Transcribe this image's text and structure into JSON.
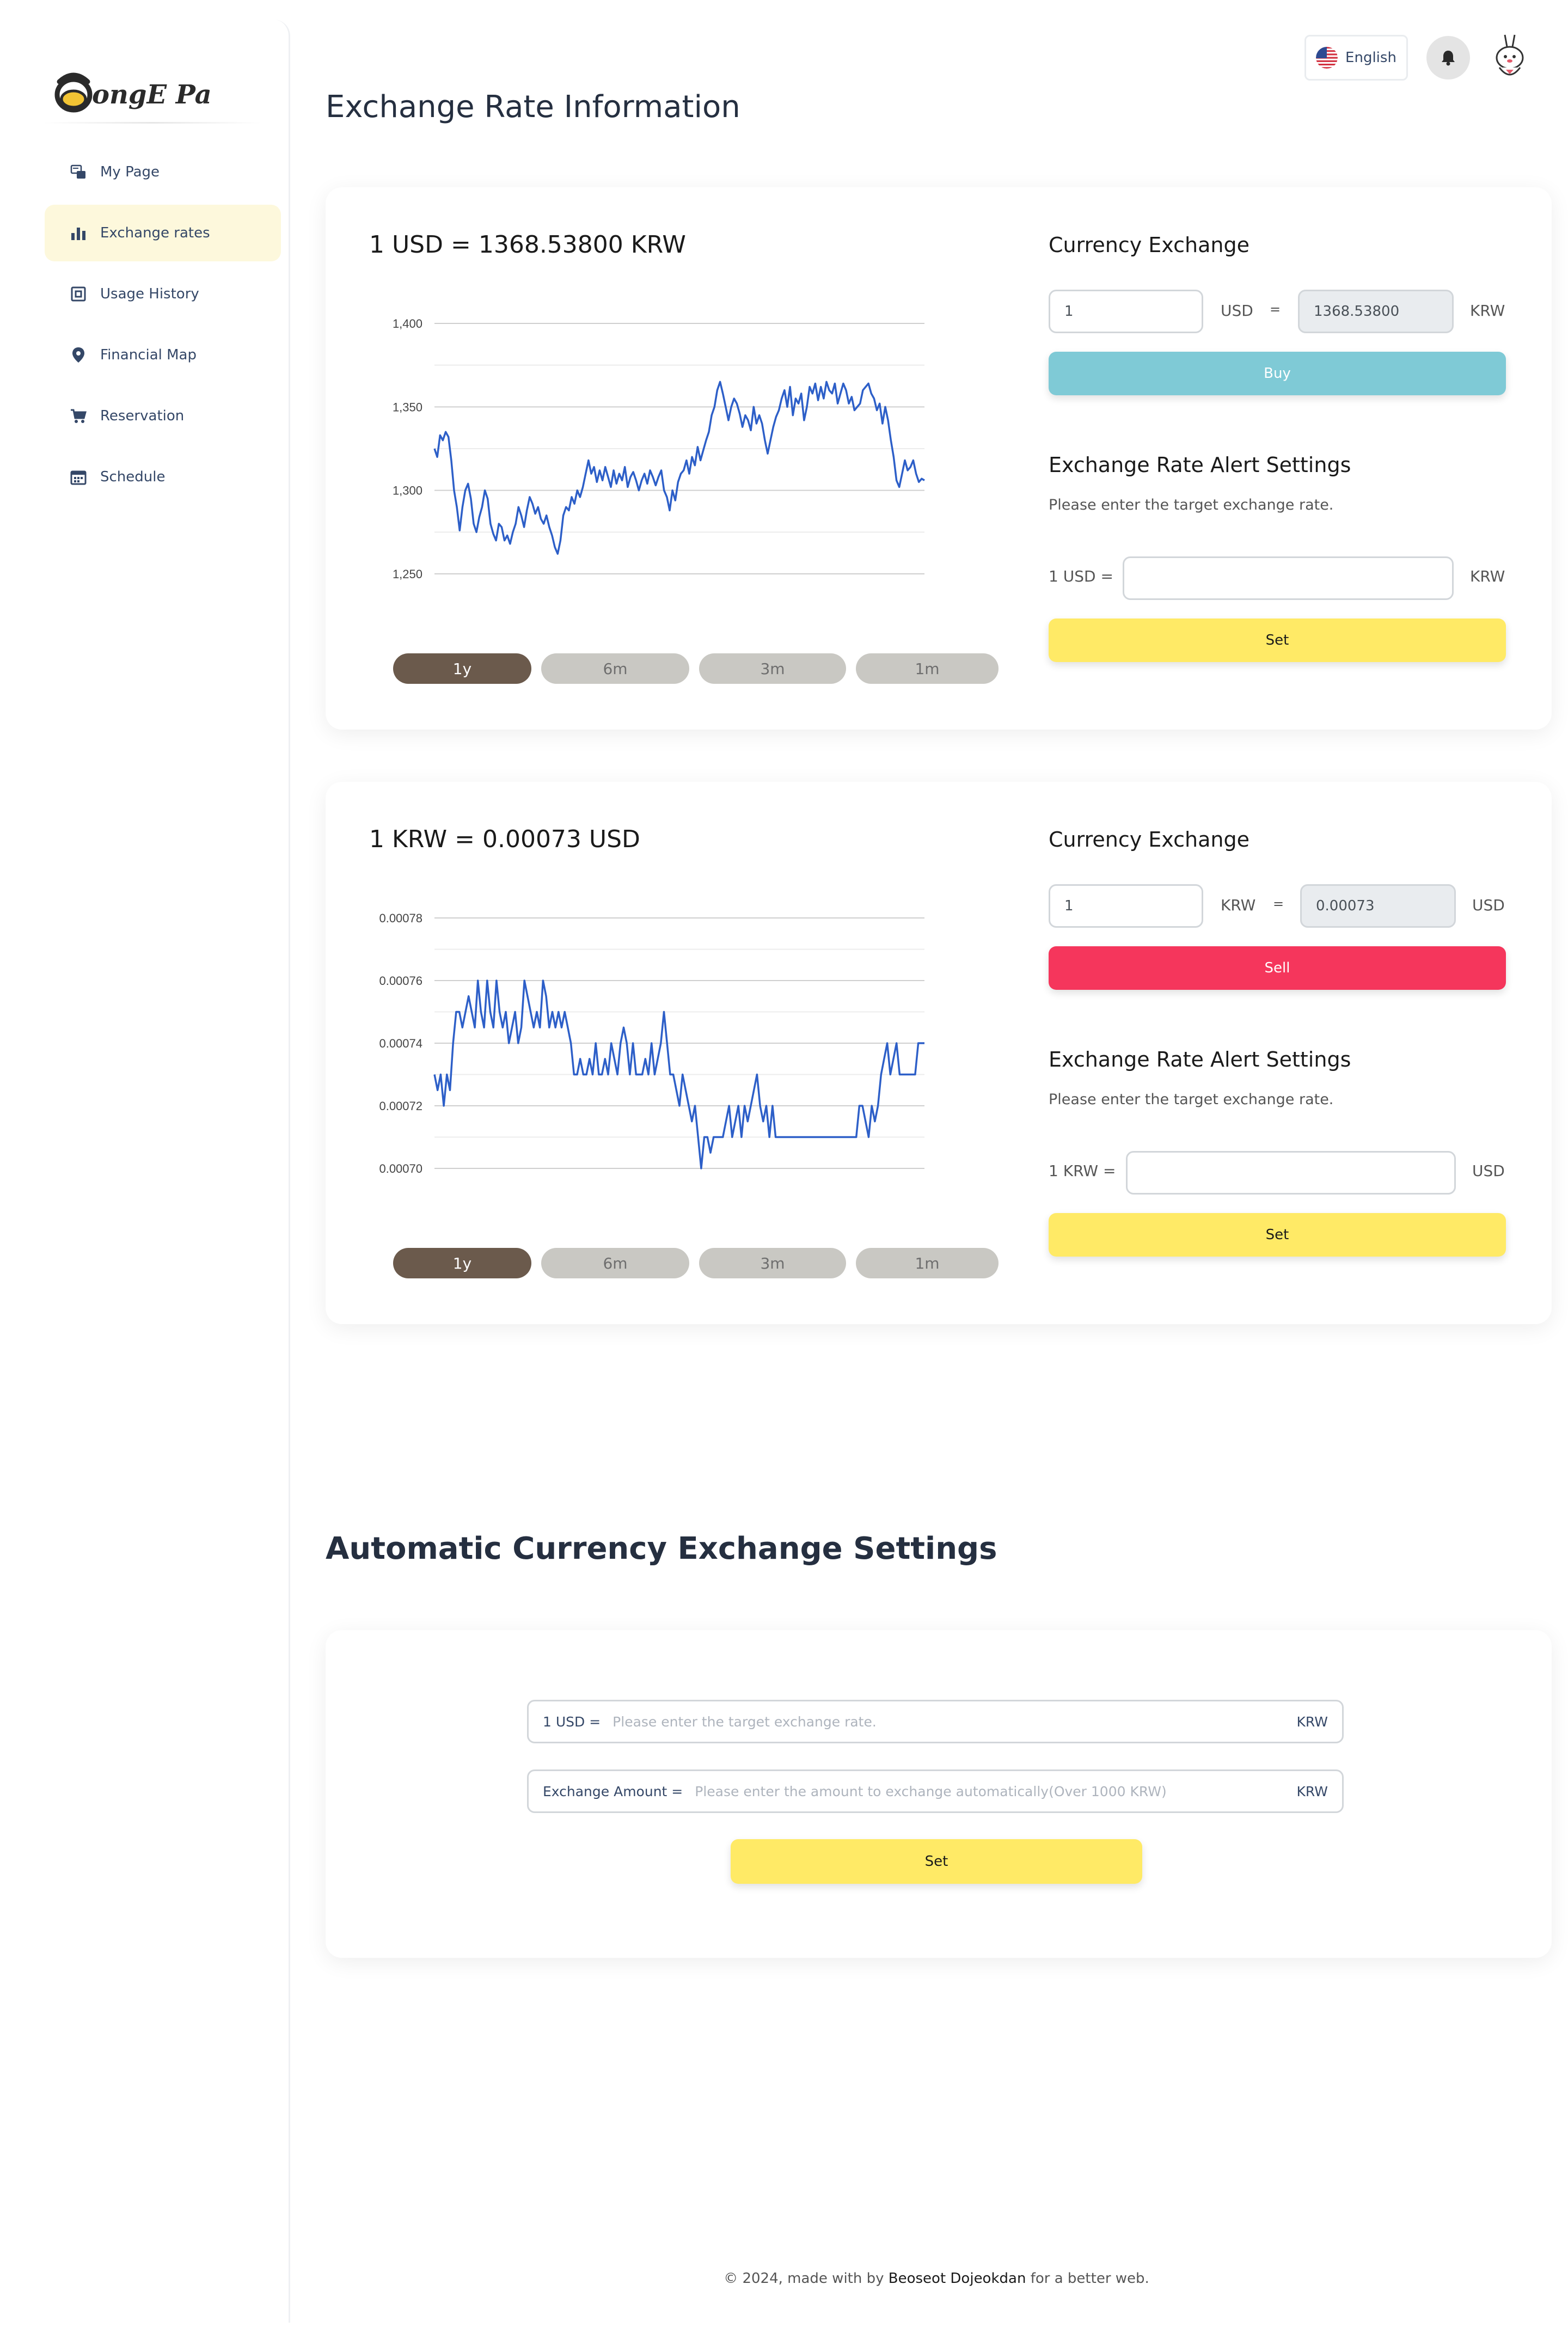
{
  "app": {
    "logo_text": "SongE Pay"
  },
  "sidebar": {
    "items": [
      {
        "label": "My Page",
        "icon": "mypage-icon"
      },
      {
        "label": "Exchange rates",
        "icon": "bar-chart-icon",
        "active": true
      },
      {
        "label": "Usage History",
        "icon": "receipt-icon"
      },
      {
        "label": "Financial Map",
        "icon": "location-pin-icon"
      },
      {
        "label": "Reservation",
        "icon": "cart-icon"
      },
      {
        "label": "Schedule",
        "icon": "calendar-icon"
      }
    ]
  },
  "topbar": {
    "language": "English"
  },
  "page": {
    "title": "Exchange Rate Information"
  },
  "usd_card": {
    "rate_title": "1 USD = 1368.53800 KRW",
    "periods": [
      "1y",
      "6m",
      "3m",
      "1m"
    ],
    "active_period": "1y",
    "exchange": {
      "title": "Currency Exchange",
      "input_value": "1",
      "from_unit": "USD",
      "equals": "=",
      "result_value": "1368.53800",
      "to_unit": "KRW",
      "button": "Buy"
    },
    "alert": {
      "title": "Exchange Rate Alert Settings",
      "subtitle": "Please enter the target exchange rate.",
      "label": "1 USD =",
      "unit": "KRW",
      "input_value": "",
      "button": "Set"
    }
  },
  "krw_card": {
    "rate_title": "1 KRW = 0.00073 USD",
    "periods": [
      "1y",
      "6m",
      "3m",
      "1m"
    ],
    "active_period": "1y",
    "exchange": {
      "title": "Currency Exchange",
      "input_value": "1",
      "from_unit": "KRW",
      "equals": "=",
      "result_value": "0.00073",
      "to_unit": "USD",
      "button": "Sell"
    },
    "alert": {
      "title": "Exchange Rate Alert Settings",
      "subtitle": "Please enter the target exchange rate.",
      "label": "1 KRW =",
      "unit": "USD",
      "input_value": "",
      "button": "Set"
    }
  },
  "auto": {
    "title": "Automatic Currency Exchange Settings",
    "rate_label": "1 USD =",
    "rate_placeholder": "Please enter the target exchange rate.",
    "rate_unit": "KRW",
    "amount_label": "Exchange Amount =",
    "amount_placeholder": "Please enter the amount to exchange automatically(Over 1000 KRW)",
    "amount_unit": "KRW",
    "button": "Set"
  },
  "footer": {
    "prefix": "© 2024, made with by",
    "author": "Beoseot Dojeokdan",
    "suffix": "for a better web."
  },
  "colors": {
    "accent_yellow": "#ffea66",
    "buy": "#7fcad6",
    "sell": "#f5365c",
    "line": "#2d5fc8",
    "period_active": "#6b5a4c"
  },
  "chart_data": [
    {
      "type": "line",
      "title": "1 USD = 1368.53800 KRW",
      "xlabel": "",
      "ylabel": "",
      "ylim": [
        1250,
        1400
      ],
      "yticks": [
        1250,
        1300,
        1350,
        1400
      ],
      "ytick_labels": [
        "1,250",
        "1,300",
        "1,350",
        "1,400"
      ],
      "grid": true,
      "series": [
        {
          "values": [
            1325,
            1320,
            1333,
            1330,
            1335,
            1332,
            1318,
            1300,
            1290,
            1276,
            1290,
            1300,
            1304,
            1295,
            1280,
            1275,
            1284,
            1290,
            1300,
            1295,
            1280,
            1274,
            1270,
            1280,
            1278,
            1270,
            1273,
            1268,
            1275,
            1280,
            1290,
            1285,
            1278,
            1288,
            1296,
            1292,
            1286,
            1290,
            1283,
            1280,
            1285,
            1278,
            1273,
            1266,
            1262,
            1270,
            1285,
            1290,
            1288,
            1296,
            1292,
            1300,
            1296,
            1302,
            1310,
            1318,
            1310,
            1314,
            1305,
            1312,
            1306,
            1314,
            1308,
            1302,
            1312,
            1304,
            1310,
            1306,
            1314,
            1302,
            1308,
            1311,
            1306,
            1300,
            1306,
            1310,
            1304,
            1312,
            1308,
            1303,
            1308,
            1312,
            1300,
            1296,
            1288,
            1300,
            1294,
            1305,
            1310,
            1312,
            1318,
            1310,
            1320,
            1315,
            1326,
            1318,
            1324,
            1330,
            1335,
            1345,
            1350,
            1360,
            1365,
            1358,
            1350,
            1342,
            1350,
            1355,
            1352,
            1346,
            1338,
            1345,
            1342,
            1336,
            1350,
            1340,
            1345,
            1340,
            1330,
            1322,
            1330,
            1338,
            1344,
            1348,
            1355,
            1360,
            1350,
            1362,
            1345,
            1355,
            1352,
            1358,
            1342,
            1350,
            1362,
            1358,
            1364,
            1354,
            1362,
            1355,
            1365,
            1360,
            1358,
            1364,
            1352,
            1358,
            1364,
            1360,
            1352,
            1356,
            1348,
            1350,
            1352,
            1360,
            1362,
            1364,
            1358,
            1355,
            1348,
            1352,
            1340,
            1350,
            1342,
            1330,
            1320,
            1306,
            1302,
            1310,
            1318,
            1312,
            1314,
            1318,
            1310,
            1305,
            1307,
            1306
          ]
        }
      ]
    },
    {
      "type": "line",
      "title": "1 KRW = 0.00073 USD",
      "xlabel": "",
      "ylabel": "",
      "ylim": [
        0.0007,
        0.00078
      ],
      "yticks": [
        0.0007,
        0.00072,
        0.00074,
        0.00076,
        0.00078
      ],
      "ytick_labels": [
        "0.00070",
        "0.00072",
        "0.00074",
        "0.00076",
        "0.00078"
      ],
      "grid": true,
      "series": [
        {
          "values": [
            0.00073,
            0.000725,
            0.00073,
            0.00072,
            0.00073,
            0.000725,
            0.00074,
            0.00075,
            0.00075,
            0.000745,
            0.00075,
            0.000755,
            0.00075,
            0.000745,
            0.00076,
            0.00075,
            0.000745,
            0.00076,
            0.00075,
            0.000745,
            0.00076,
            0.00075,
            0.000745,
            0.00075,
            0.00074,
            0.000745,
            0.00075,
            0.00074,
            0.000745,
            0.00076,
            0.000755,
            0.00075,
            0.000745,
            0.00075,
            0.000745,
            0.00076,
            0.000755,
            0.000745,
            0.00075,
            0.000745,
            0.00075,
            0.000745,
            0.00075,
            0.000745,
            0.00074,
            0.00073,
            0.00073,
            0.000735,
            0.00073,
            0.00073,
            0.000735,
            0.00073,
            0.00074,
            0.00073,
            0.00073,
            0.000735,
            0.00073,
            0.00074,
            0.000735,
            0.00073,
            0.00074,
            0.000745,
            0.00074,
            0.00073,
            0.00074,
            0.00073,
            0.00073,
            0.00073,
            0.000735,
            0.00073,
            0.00074,
            0.00073,
            0.000735,
            0.00074,
            0.00075,
            0.00074,
            0.00073,
            0.00073,
            0.000725,
            0.00072,
            0.00073,
            0.000725,
            0.00072,
            0.000715,
            0.00072,
            0.00071,
            0.0007,
            0.00071,
            0.00071,
            0.000705,
            0.00071,
            0.00071,
            0.00071,
            0.00071,
            0.000715,
            0.00072,
            0.00071,
            0.000715,
            0.00072,
            0.00071,
            0.00072,
            0.000715,
            0.00072,
            0.000725,
            0.00073,
            0.00072,
            0.000715,
            0.00072,
            0.00071,
            0.00072,
            0.00071,
            0.00071,
            0.00071,
            0.00071,
            0.00071,
            0.00071,
            0.00071,
            0.00071,
            0.00071,
            0.00071,
            0.00071,
            0.00071,
            0.00071,
            0.00071,
            0.00071,
            0.00071,
            0.00071,
            0.00071,
            0.00071,
            0.00071,
            0.00071,
            0.00071,
            0.00071,
            0.00071,
            0.00071,
            0.00071,
            0.00071,
            0.00072,
            0.00072,
            0.000715,
            0.00071,
            0.00072,
            0.000715,
            0.00072,
            0.00073,
            0.000735,
            0.00074,
            0.00073,
            0.000735,
            0.00074,
            0.00073,
            0.00073,
            0.00073,
            0.00073,
            0.00073,
            0.00073,
            0.00074,
            0.00074,
            0.00074
          ]
        }
      ]
    }
  ]
}
